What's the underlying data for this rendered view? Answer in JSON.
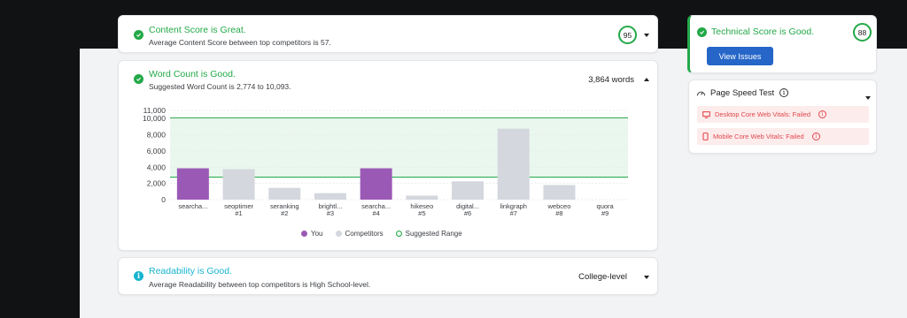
{
  "content_score": {
    "title": "Content Score is Great.",
    "subtitle": "Average Content Score between top competitors is 57.",
    "score": "95"
  },
  "word_count": {
    "title": "Word Count is Good.",
    "subtitle": "Suggested Word Count is 2,774 to 10,093.",
    "value": "3,864 words"
  },
  "readability": {
    "title": "Readability is Good.",
    "subtitle": "Average Readability between top competitors is High School-level.",
    "level": "College-level"
  },
  "technical_score": {
    "title": "Technical Score is Good.",
    "score": "88",
    "button_label": "View Issues"
  },
  "page_speed": {
    "title": "Page Speed Test",
    "items": [
      {
        "label": "Desktop Core Web Vitals: Failed",
        "icon": "monitor-icon"
      },
      {
        "label": "Mobile Core Web Vitals: Failed",
        "icon": "mobile-icon"
      }
    ]
  },
  "legend": {
    "you": "You",
    "competitors": "Competitors",
    "range": "Suggested Range"
  },
  "colors": {
    "green": "#23a948",
    "purple": "#9b59b6",
    "gray_bar": "#d4d7dd",
    "range_fill": "#eaf7ee",
    "blue_button": "#2566c8",
    "cyan": "#17b4cf",
    "fail_red": "#e0474c"
  },
  "chart_data": {
    "type": "bar",
    "categories": [
      {
        "name": "searcha...",
        "rank": ""
      },
      {
        "name": "seoptimer",
        "rank": "#1"
      },
      {
        "name": "seranking",
        "rank": "#2"
      },
      {
        "name": "brightl...",
        "rank": "#3"
      },
      {
        "name": "searcha...",
        "rank": "#4"
      },
      {
        "name": "hikeseo",
        "rank": "#5"
      },
      {
        "name": "digital...",
        "rank": "#6"
      },
      {
        "name": "linkgraph",
        "rank": "#7"
      },
      {
        "name": "webceo",
        "rank": "#8"
      },
      {
        "name": "quora",
        "rank": "#9"
      }
    ],
    "values": [
      3864,
      3750,
      1450,
      800,
      3864,
      500,
      2250,
      8750,
      1800,
      0
    ],
    "is_you": [
      true,
      false,
      false,
      false,
      true,
      false,
      false,
      false,
      false,
      false
    ],
    "yticks": [
      "0",
      "2,000",
      "4,000",
      "6,000",
      "8,000",
      "10,000",
      "11,000"
    ],
    "ytick_values": [
      0,
      2000,
      4000,
      6000,
      8000,
      10000,
      11000
    ],
    "ylim": [
      0,
      11000
    ],
    "suggested_range": [
      2774,
      10093
    ],
    "grid": true
  }
}
